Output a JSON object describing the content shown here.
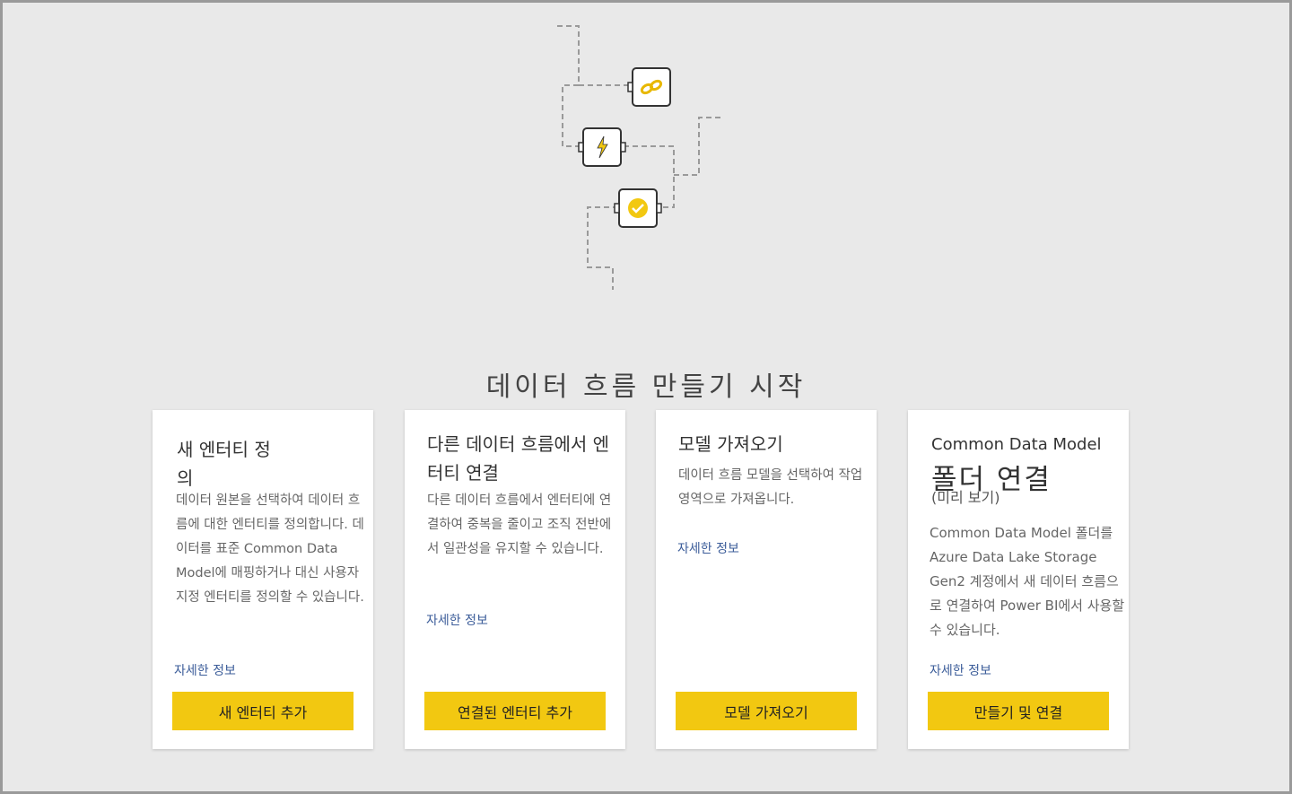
{
  "page": {
    "title": "데이터 흐름 만들기 시작"
  },
  "cards": [
    {
      "title": "새 엔터티 정의",
      "description": "데이터 원본을 선택하여 데이터 흐름에 대한 엔터티를 정의합니다. 데이터를 표준 Common Data Model에 매핑하거나 대신 사용자 지정 엔터티를 정의할 수 있습니다.",
      "link": "자세한 정보",
      "button": "새 엔터티 추가"
    },
    {
      "title": "다른 데이터 흐름에서 엔터티 연결",
      "description": "다른 데이터 흐름에서 엔터티에 연결하여 중복을 줄이고 조직 전반에서 일관성을 유지할 수 있습니다.",
      "link": "자세한 정보",
      "button": "연결된 엔터티 추가"
    },
    {
      "title": "모델 가져오기",
      "description": "데이터 흐름 모델을 선택하여 작업 영역으로 가져옵니다.",
      "link": "자세한 정보",
      "button": "모델 가져오기"
    },
    {
      "title_line1": "Common Data Model",
      "title_line2": "폴더 연결",
      "title_line3": "(미리 보기)",
      "description": "Common Data Model 폴더를 Azure Data Lake Storage Gen2 계정에서 새 데이터 흐름으로 연결하여 Power BI에서 사용할 수 있습니다.",
      "link": "자세한 정보",
      "button": "만들기 및 연결"
    }
  ],
  "colors": {
    "accent": "#f2c811",
    "background": "#e9e9e9",
    "link": "#3b5c99"
  },
  "icons": [
    "link-icon",
    "lightning-icon",
    "check-badge-icon"
  ]
}
